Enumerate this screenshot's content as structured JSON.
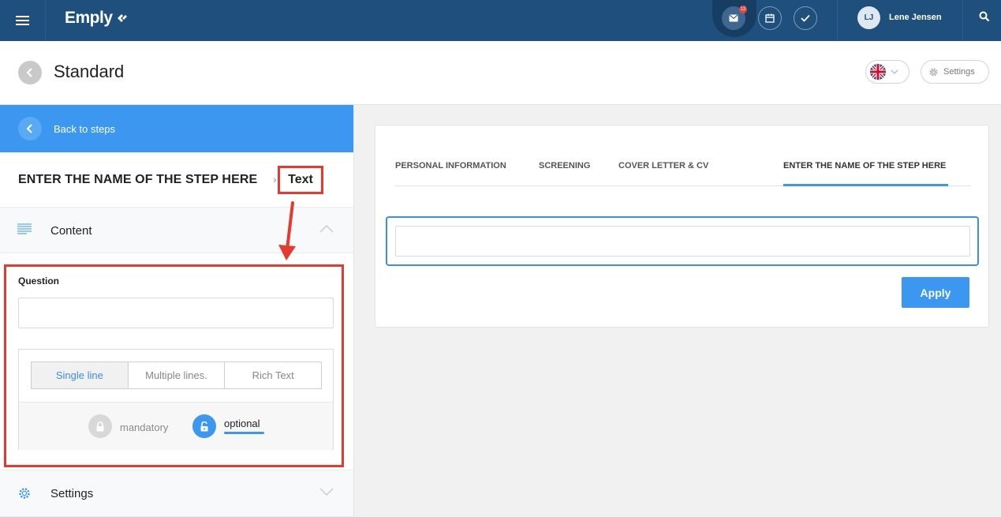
{
  "topbar": {
    "logo": "Emply",
    "mail_badge": "12",
    "user_initials": "LJ",
    "user_name": "Lene Jensen"
  },
  "header": {
    "title": "Standard",
    "settings_label": "Settings"
  },
  "left_panel": {
    "back_label": "Back to steps",
    "step_name": "ENTER THE NAME OF THE STEP HERE",
    "separator": "›",
    "step_type": "Text",
    "content_label": "Content",
    "question_label": "Question",
    "question_value": "",
    "line_modes": [
      "Single line",
      "Multiple lines.",
      "Rich Text"
    ],
    "selected_mode": "Single line",
    "mandatory_label": "mandatory",
    "optional_label": "optional",
    "settings_label": "Settings"
  },
  "preview": {
    "tabs": [
      "PERSONAL INFORMATION",
      "SCREENING",
      "COVER LETTER & CV",
      "ENTER THE NAME OF THE STEP HERE"
    ],
    "active_tab": "ENTER THE NAME OF THE STEP HERE",
    "input_value": "",
    "apply_label": "Apply"
  },
  "colors": {
    "nav_bg": "#1f4f7c",
    "accent": "#3b97f0",
    "highlight_red": "#e53a2f"
  }
}
